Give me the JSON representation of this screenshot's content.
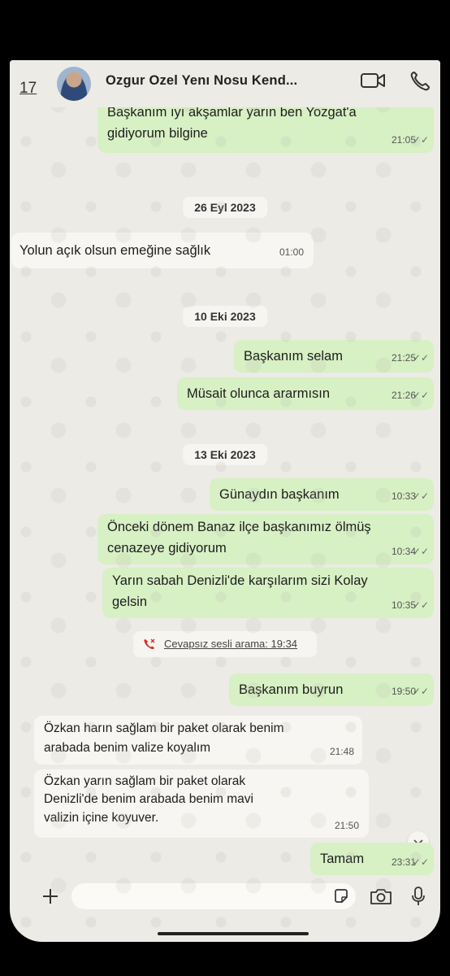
{
  "header": {
    "back_count": "17",
    "contact_name": "Ozgur Ozel Yenı Nosu Kend...",
    "icons": [
      "video-call-icon",
      "phone-call-icon"
    ]
  },
  "messages": {
    "m1": {
      "text": "Başkanım ıyı akşamlar yarın ben Yozgat'a gidiyorum bilgine",
      "line1": "Başkanım ıyı akşamlar yarın ben Yozgat'a",
      "line2": "gidiyorum bilgine",
      "time": "21:05"
    },
    "d1": "26 Eyl 2023",
    "m2": {
      "text": "Yolun açık olsun emeğine sağlık",
      "time": "01:00"
    },
    "d2": "10 Eki 2023",
    "m3": {
      "text": "Başkanım selam",
      "time": "21:25"
    },
    "m4": {
      "text": "Müsait olunca ararmısın",
      "time": "21:26"
    },
    "d3": "13 Eki 2023",
    "m5": {
      "text": "Günaydın başkanım",
      "time": "10:33"
    },
    "m6": {
      "line1": "Önceki dönem Banaz ilçe başkanımız ölmüş",
      "line2": "cenazeye gidiyorum",
      "time": "10:34"
    },
    "m7": {
      "line1": "Yarın sabah Denizli'de  karşılarım sizi Kolay",
      "line2": "gelsin",
      "time": "10:35"
    },
    "call": "Cevapsız sesli arama: 19:34",
    "m8": {
      "text": "Başkanım buyrun",
      "time": "19:50"
    },
    "m9": {
      "line1": "Özkan harın sağlam bir paket olarak benim",
      "line2": "arabada benim valize koyalım",
      "time": "21:48"
    },
    "m10": {
      "line1": "Özkan yarın sağlam bir paket olarak",
      "line2": "Denizli'de benim arabada benim mavi",
      "line3": "valizin içine koyuver.",
      "time": "21:50"
    },
    "m11": {
      "text": "Tamam",
      "time": "23:31"
    }
  },
  "colors": {
    "outgoing": "#d7f0c4",
    "incoming": "#f7f6f2",
    "background": "#ecebe6"
  }
}
